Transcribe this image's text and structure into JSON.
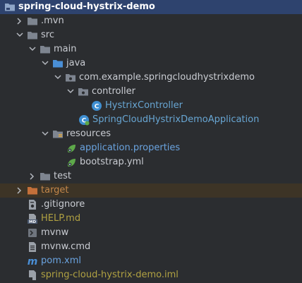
{
  "project_tree": {
    "root": {
      "label": "spring-cloud-hystrix-demo"
    },
    "mvn": {
      "label": ".mvn"
    },
    "src": {
      "label": "src"
    },
    "main": {
      "label": "main"
    },
    "java": {
      "label": "java"
    },
    "package": {
      "label": "com.example.springcloudhystrixdemo"
    },
    "controller": {
      "label": "controller"
    },
    "hystrix_controller": {
      "label": "HystrixController"
    },
    "application_class": {
      "label": "SpringCloudHystrixDemoApplication"
    },
    "resources": {
      "label": "resources"
    },
    "application_properties": {
      "label": "application.properties"
    },
    "bootstrap_yml": {
      "label": "bootstrap.yml"
    },
    "test": {
      "label": "test"
    },
    "target": {
      "label": "target"
    },
    "gitignore": {
      "label": ".gitignore"
    },
    "help_md": {
      "label": "HELP.md"
    },
    "mvnw": {
      "label": "mvnw"
    },
    "mvnw_cmd": {
      "label": "mvnw.cmd"
    },
    "pom_xml": {
      "label": "pom.xml"
    },
    "iml": {
      "label": "spring-cloud-hystrix-demo.iml"
    }
  },
  "icons": {
    "class_badge": "C",
    "markdown_badge": "MD"
  },
  "colors": {
    "background": "#2b2d30",
    "selected_row": "#2e436e",
    "excluded_row": "#3d3426",
    "folder": "#7e8590",
    "source_folder": "#4a8fd6",
    "excluded_folder": "#c4703a",
    "spring_green": "#5ea94a",
    "class_blue": "#3f8fd1"
  }
}
